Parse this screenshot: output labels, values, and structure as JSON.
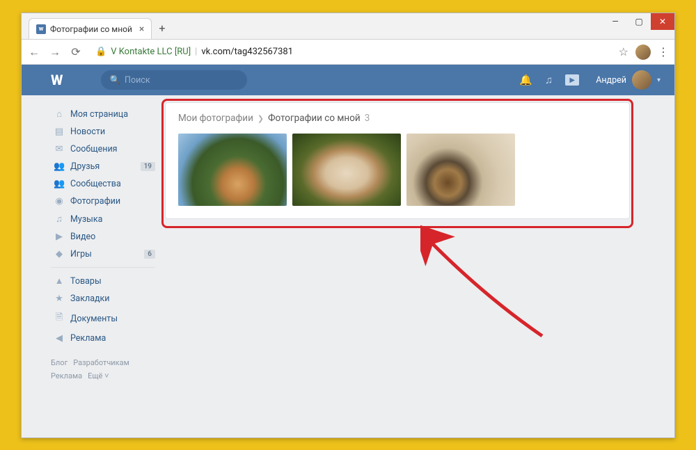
{
  "browser": {
    "tab_title": "Фотографии со мной",
    "url_identity": "V Kontakte LLC [RU]",
    "url_path": "vk.com/tag432567381"
  },
  "vk": {
    "search_placeholder": "Поиск",
    "username": "Андрей"
  },
  "sidebar": {
    "items": [
      {
        "icon": "⌂",
        "label": "Моя страница"
      },
      {
        "icon": "▤",
        "label": "Новости"
      },
      {
        "icon": "✉",
        "label": "Сообщения"
      },
      {
        "icon": "👥",
        "label": "Друзья",
        "badge": "19"
      },
      {
        "icon": "👥",
        "label": "Сообщества"
      },
      {
        "icon": "📷",
        "label": "Фотографии"
      },
      {
        "icon": "♫",
        "label": "Музыка"
      },
      {
        "icon": "🎬",
        "label": "Видео"
      },
      {
        "icon": "🎮",
        "label": "Игры",
        "badge": "6"
      }
    ],
    "items2": [
      {
        "icon": "🛍",
        "label": "Товары"
      },
      {
        "icon": "★",
        "label": "Закладки"
      },
      {
        "icon": "🗎",
        "label": "Документы"
      },
      {
        "icon": "📢",
        "label": "Реклама"
      }
    ]
  },
  "footer": {
    "row1a": "Блог",
    "row1b": "Разработчикам",
    "row2a": "Реклама",
    "row2b": "Ещё ˅"
  },
  "breadcrumb": {
    "parent": "Мои фотографии",
    "current": "Фотографии со мной",
    "count": "3"
  }
}
